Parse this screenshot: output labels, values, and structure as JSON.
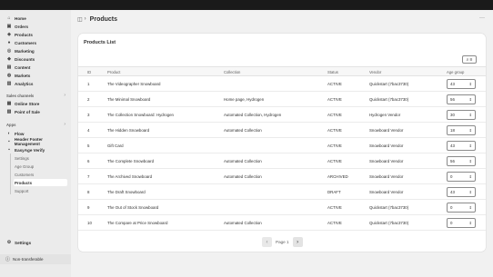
{
  "sidebar": {
    "primary": [
      {
        "label": "Home",
        "icon": "home-icon",
        "glyph": "⌂"
      },
      {
        "label": "Orders",
        "icon": "orders-icon",
        "glyph": "▣"
      },
      {
        "label": "Products",
        "icon": "tag-icon",
        "glyph": "◈"
      },
      {
        "label": "Customers",
        "icon": "person-icon",
        "glyph": "●"
      },
      {
        "label": "Marketing",
        "icon": "target-icon",
        "glyph": "◎"
      },
      {
        "label": "Discounts",
        "icon": "discount-icon",
        "glyph": "◆"
      },
      {
        "label": "Content",
        "icon": "content-icon",
        "glyph": "▤"
      },
      {
        "label": "Markets",
        "icon": "globe-icon",
        "glyph": "◍"
      },
      {
        "label": "Analytics",
        "icon": "chart-icon",
        "glyph": "▥"
      }
    ],
    "sales_channels_label": "Sales channels",
    "sales_channels": [
      {
        "label": "Online Store",
        "icon": "store-icon",
        "glyph": "▦"
      },
      {
        "label": "Point of Sale",
        "icon": "pos-icon",
        "glyph": "▧"
      }
    ],
    "apps_label": "Apps",
    "apps": [
      {
        "label": "Flow",
        "icon": "flow-icon",
        "glyph": "◐"
      },
      {
        "label": "Header Footer Management",
        "icon": "app-icon",
        "glyph": "▪"
      },
      {
        "label": "EasyAge Verify",
        "icon": "app-icon",
        "glyph": "▪"
      }
    ],
    "app_subitems": [
      "Settings",
      "Age Group",
      "Customers",
      "Products",
      "Support"
    ],
    "settings_label": "Settings",
    "non_transferable": "Non-transferable"
  },
  "header": {
    "title": "Products"
  },
  "card": {
    "title": "Products List",
    "columns": [
      "ID",
      "Product",
      "Collection",
      "Status",
      "Vendor",
      "Age group"
    ],
    "rows": [
      {
        "id": "1",
        "product": "The Videographer Snowboard",
        "collection": "",
        "status": "ACTIVE",
        "vendor": "Quickstart (7bac3730)",
        "age": "43"
      },
      {
        "id": "2",
        "product": "The Minimal Snowboard",
        "collection": "Home page, Hydrogen",
        "status": "ACTIVE",
        "vendor": "Quickstart (7bac3730)",
        "age": "56"
      },
      {
        "id": "3",
        "product": "The Collection Snowboard: Hydrogen",
        "collection": "Automated Collection, Hydrogen",
        "status": "ACTIVE",
        "vendor": "Hydrogen Vendor",
        "age": "30"
      },
      {
        "id": "4",
        "product": "The Hidden Snowboard",
        "collection": "Automated Collection",
        "status": "ACTIVE",
        "vendor": "Snowboard Vendor",
        "age": "18"
      },
      {
        "id": "5",
        "product": "Gift Card",
        "collection": "",
        "status": "ACTIVE",
        "vendor": "Snowboard Vendor",
        "age": "43"
      },
      {
        "id": "6",
        "product": "The Complete Snowboard",
        "collection": "Automated Collection",
        "status": "ACTIVE",
        "vendor": "Snowboard Vendor",
        "age": "56"
      },
      {
        "id": "7",
        "product": "The Archived Snowboard",
        "collection": "Automated Collection",
        "status": "ARCHIVED",
        "vendor": "Snowboard Vendor",
        "age": "0"
      },
      {
        "id": "8",
        "product": "The Draft Snowboard",
        "collection": "",
        "status": "DRAFT",
        "vendor": "Snowboard Vendor",
        "age": "43"
      },
      {
        "id": "9",
        "product": "The Out of Stock Snowboard",
        "collection": "",
        "status": "ACTIVE",
        "vendor": "Quickstart (7bac3730)",
        "age": "0"
      },
      {
        "id": "10",
        "product": "The Compare at Price Snowboard",
        "collection": "Automated Collection",
        "status": "ACTIVE",
        "vendor": "Quickstart (7bac3730)",
        "age": "0"
      }
    ],
    "pagination": {
      "label": "Page 1"
    }
  }
}
